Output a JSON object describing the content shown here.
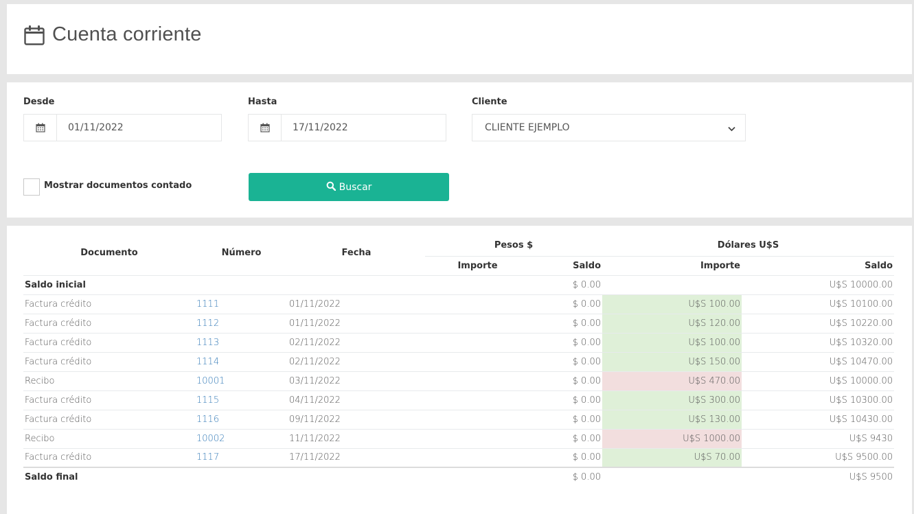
{
  "title": {
    "text": "Cuenta corriente",
    "icon": "calendar-icon"
  },
  "filters": {
    "desde": {
      "label": "Desde",
      "value": "01/11/2022"
    },
    "hasta": {
      "label": "Hasta",
      "value": "17/11/2022"
    },
    "cliente": {
      "label": "Cliente",
      "value": "CLIENTE EJEMPLO"
    },
    "checkbox_label": "Mostrar documentos contado",
    "search_label": "Buscar"
  },
  "table": {
    "headers": {
      "documento": "Documento",
      "numero": "Número",
      "fecha": "Fecha",
      "pesos": "Pesos $",
      "dolares": "Dólares U$S",
      "importe": "Importe",
      "saldo": "Saldo"
    },
    "initial": {
      "label": "Saldo inicial",
      "saldo_pesos": "$ 0.00",
      "saldo_dolares": "U$S 10000.00"
    },
    "rows": [
      {
        "documento": "Factura crédito",
        "numero": "1111",
        "fecha": "01/11/2022",
        "importe_pesos": "",
        "saldo_pesos": "$ 0.00",
        "importe_dolares": "U$S 100.00",
        "saldo_dolares": "U$S 10100.00",
        "kind": "credit"
      },
      {
        "documento": "Factura crédito",
        "numero": "1112",
        "fecha": "01/11/2022",
        "importe_pesos": "",
        "saldo_pesos": "$ 0.00",
        "importe_dolares": "U$S 120.00",
        "saldo_dolares": "U$S 10220.00",
        "kind": "credit"
      },
      {
        "documento": "Factura crédito",
        "numero": "1113",
        "fecha": "02/11/2022",
        "importe_pesos": "",
        "saldo_pesos": "$ 0.00",
        "importe_dolares": "U$S 100.00",
        "saldo_dolares": "U$S 10320.00",
        "kind": "credit"
      },
      {
        "documento": "Factura crédito",
        "numero": "1114",
        "fecha": "02/11/2022",
        "importe_pesos": "",
        "saldo_pesos": "$ 0.00",
        "importe_dolares": "U$S 150.00",
        "saldo_dolares": "U$S 10470.00",
        "kind": "credit"
      },
      {
        "documento": "Recibo",
        "numero": "10001",
        "fecha": "03/11/2022",
        "importe_pesos": "",
        "saldo_pesos": "$ 0.00",
        "importe_dolares": "U$S 470.00",
        "saldo_dolares": "U$S 10000.00",
        "kind": "debit"
      },
      {
        "documento": "Factura crédito",
        "numero": "1115",
        "fecha": "04/11/2022",
        "importe_pesos": "",
        "saldo_pesos": "$ 0.00",
        "importe_dolares": "U$S 300.00",
        "saldo_dolares": "U$S 10300.00",
        "kind": "credit"
      },
      {
        "documento": "Factura crédito",
        "numero": "1116",
        "fecha": "09/11/2022",
        "importe_pesos": "",
        "saldo_pesos": "$ 0.00",
        "importe_dolares": "U$S 130.00",
        "saldo_dolares": "U$S 10430.00",
        "kind": "credit"
      },
      {
        "documento": "Recibo",
        "numero": "10002",
        "fecha": "11/11/2022",
        "importe_pesos": "",
        "saldo_pesos": "$ 0.00",
        "importe_dolares": "U$S 1000.00",
        "saldo_dolares": "U$S 9430",
        "kind": "debit"
      },
      {
        "documento": "Factura crédito",
        "numero": "1117",
        "fecha": "17/11/2022",
        "importe_pesos": "",
        "saldo_pesos": "$ 0.00",
        "importe_dolares": "U$S 70.00",
        "saldo_dolares": "U$S 9500.00",
        "kind": "credit"
      }
    ],
    "final": {
      "label": "Saldo final",
      "saldo_pesos": "$ 0.00",
      "saldo_dolares": "U$S 9500"
    }
  },
  "colors": {
    "accent": "#1ab394",
    "link": "#337ab7",
    "credit_bg": "#dff0d8",
    "debit_bg": "#f2dede"
  }
}
